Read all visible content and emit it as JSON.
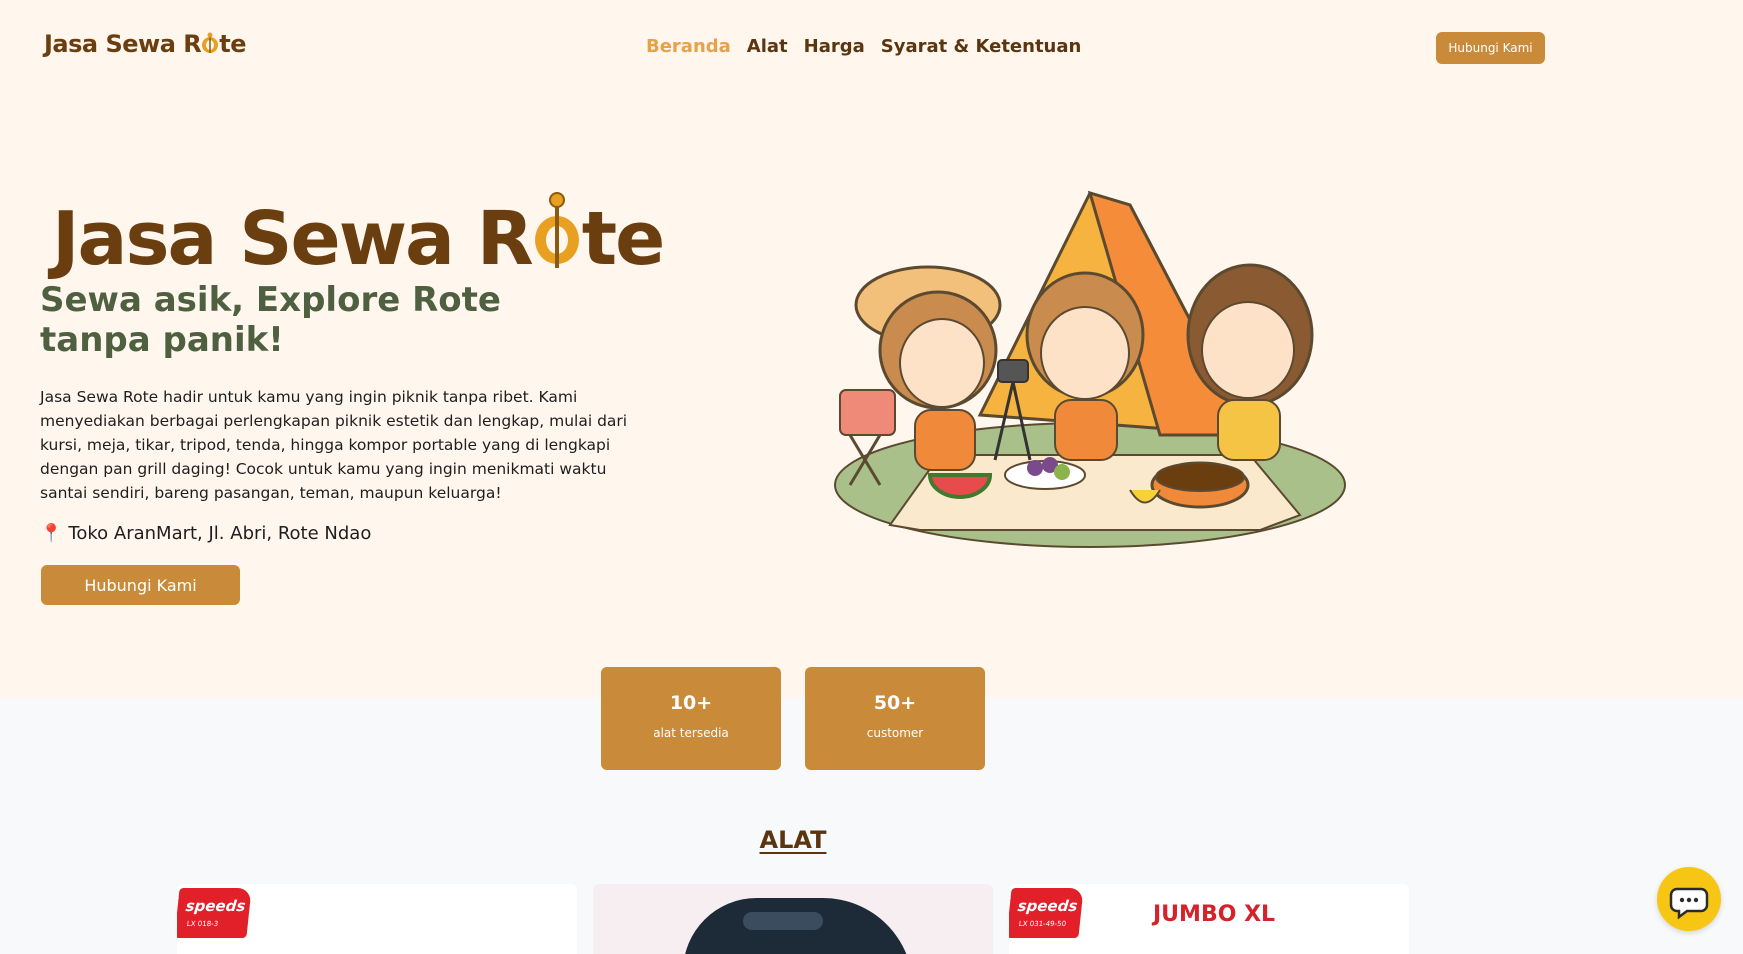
{
  "brand": {
    "name_prefix": "Jasa Sewa R",
    "name_suffix": "te"
  },
  "nav": {
    "links": [
      "Beranda",
      "Alat",
      "Harga",
      "Syarat & Ketentuan"
    ],
    "active_index": 0,
    "cta_label": "Hubungi Kami"
  },
  "hero": {
    "title_prefix": "Jasa Sewa R",
    "title_suffix": "te",
    "subtitle": "Sewa asik, Explore Rote tanpa panik!",
    "description": "Jasa Sewa Rote hadir untuk kamu yang ingin piknik tanpa ribet. Kami menyediakan berbagai perlengkapan piknik estetik dan lengkap, mulai dari kursi, meja, tikar, tripod, tenda, hingga kompor portable yang di lengkapi dengan pan grill daging! Cocok untuk kamu yang ingin menikmati waktu santai sendiri, bareng pasangan, teman, maupun keluarga!",
    "location_icon": "📍",
    "location": "Toko AranMart, Jl. Abri, Rote Ndao",
    "cta_label": "Hubungi Kami"
  },
  "stats": [
    {
      "value": "10+",
      "label": "alat tersedia"
    },
    {
      "value": "50+",
      "label": "customer"
    }
  ],
  "section": {
    "title": "ALAT"
  },
  "products": [
    {
      "brand": "speeds",
      "code": "LX 018-3"
    },
    {
      "brand": "",
      "code": ""
    },
    {
      "brand": "speeds",
      "code": "LX 031-49-50",
      "headline": "JUMBO XL"
    }
  ],
  "colors": {
    "accent": "#c98a3a",
    "brand_brown": "#6b3e10",
    "active_link": "#e8a04b",
    "subtitle_green": "#4f6040",
    "hero_bg": "#fff6ee",
    "chat_yellow": "#f7c614"
  },
  "icons": {
    "chat": "chat-bubble-icon",
    "location": "map-pin-icon",
    "brand_o": "sasando-icon"
  }
}
